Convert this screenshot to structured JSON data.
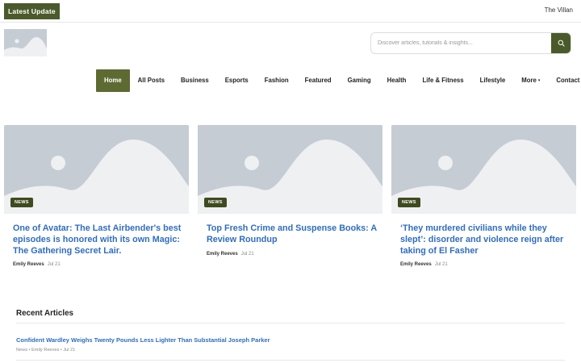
{
  "topbar": {
    "latest_label": "Latest  Update",
    "right_link": "The Villan"
  },
  "logo": {
    "icon": "image-placeholder-icon"
  },
  "search": {
    "placeholder": "Discover articles, tutorials & insights...",
    "value": "",
    "icon": "search-icon"
  },
  "nav": {
    "items": [
      "Home",
      "All Posts",
      "Business",
      "Esports",
      "Fashion",
      "Featured",
      "Gaming",
      "Health",
      "Life & Fitness",
      "Lifestyle",
      "More",
      "Contact Us"
    ],
    "more_caret": "▾",
    "active_index": 0
  },
  "cards": [
    {
      "tag": "NEWS",
      "title": "One of Avatar: The Last Airbender's best episodes is honored with its own Magic: The Gathering Secret Lair.",
      "author": "Emily Reeves",
      "date": "Jul 21"
    },
    {
      "tag": "NEWS",
      "title": "Top Fresh Crime and Suspense Books: A Review Roundup",
      "author": "Emily Reeves",
      "date": "Jul 21"
    },
    {
      "tag": "NEWS",
      "title": "‘They murdered civilians while they slept’: disorder and violence reign after taking of El Fasher",
      "author": "Emily Reeves",
      "date": "Jul 21"
    }
  ],
  "recent": {
    "heading": "Recent Articles",
    "items": [
      {
        "title": "Confident Wardley Weighs Twenty Pounds Less Lighter Than Substantial Joseph Parker",
        "meta": "News • Emily Reeves • Jul 21"
      }
    ]
  },
  "colors": {
    "accent": "#4b5a2b",
    "nav_active": "#5d6b32",
    "tag": "#3f4a1f",
    "link": "#2f6dbf",
    "placeholder_bg": "#c6ccd4",
    "placeholder_shape": "#eef0f2"
  }
}
